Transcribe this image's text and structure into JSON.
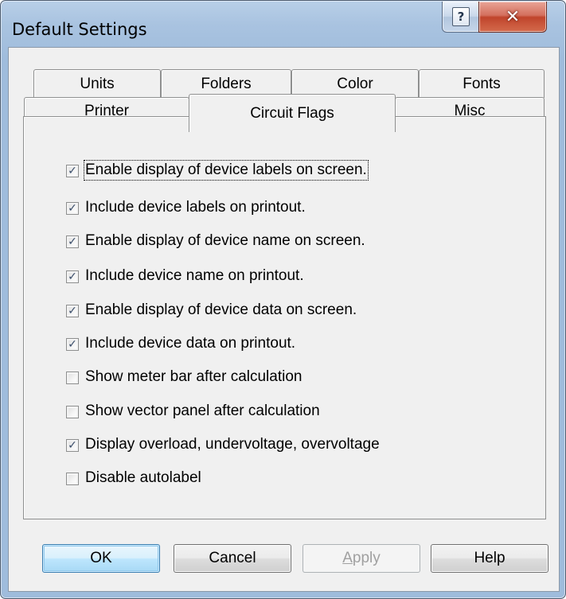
{
  "window": {
    "title": "Default Settings",
    "help_glyph": "?",
    "close_glyph": "✕"
  },
  "tabs": {
    "row_back": [
      "Units",
      "Folders",
      "Color",
      "Fonts"
    ],
    "row_front": [
      "Printer",
      "Circuit Flags",
      "Misc"
    ],
    "active": "Circuit Flags"
  },
  "options": [
    {
      "label": "Enable display of device labels on screen.",
      "checked": true,
      "focused": true
    },
    {
      "label": "Include device labels on printout.",
      "checked": true
    },
    {
      "label": "Enable display of device name on screen.",
      "checked": true
    },
    {
      "label": "Include device name on printout.",
      "checked": true
    },
    {
      "label": "Enable display of device data on screen.",
      "checked": true
    },
    {
      "label": "Include device data on printout.",
      "checked": true
    },
    {
      "label": "Show meter bar after calculation",
      "checked": false
    },
    {
      "label": "Show vector panel after calculation",
      "checked": false
    },
    {
      "label": "Display overload, undervoltage, overvoltage",
      "checked": true
    },
    {
      "label": "Disable autolabel",
      "checked": false
    }
  ],
  "buttons": {
    "ok": "OK",
    "cancel": "Cancel",
    "apply_mnemonic": "A",
    "apply_rest": "pply",
    "help": "Help"
  },
  "check_glyph": "✓",
  "colors": {
    "default_button_border": "#3c7fb1",
    "close_button": "#c0452c",
    "dialog_face": "#f0f0f0"
  }
}
